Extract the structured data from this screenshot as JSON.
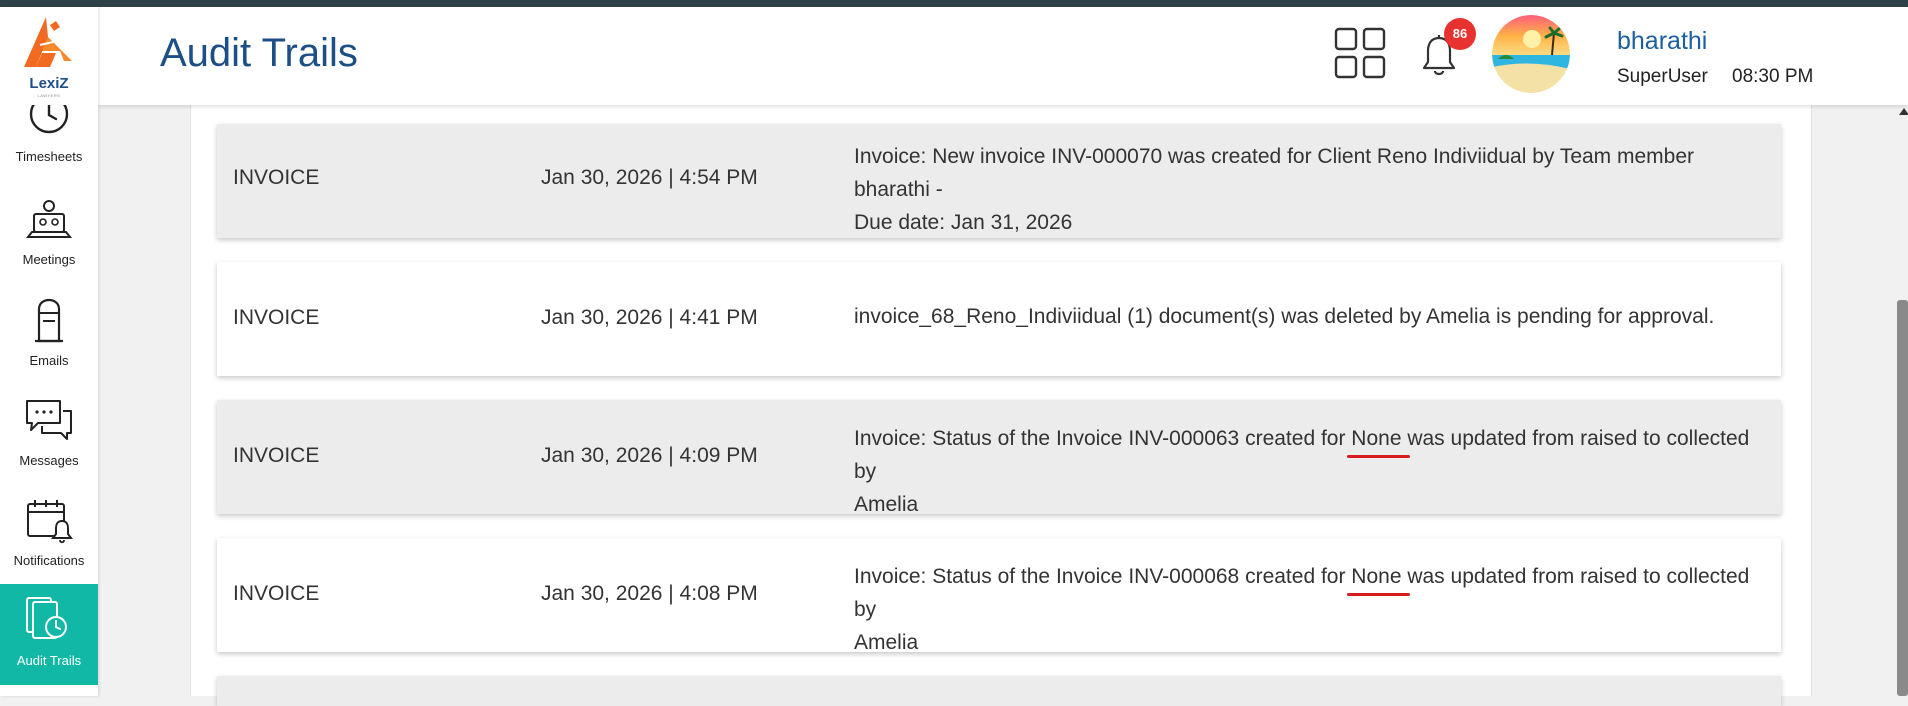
{
  "app": {
    "logo_text": "LexiZ",
    "logo_tagline": "LAWYERS"
  },
  "header": {
    "title": "Audit Trails",
    "notification_count": "86",
    "user_name": "bharathi",
    "user_role": "SuperUser",
    "time": "08:30 PM"
  },
  "sidebar": {
    "items": [
      {
        "label": "Timesheets",
        "icon": "clock-icon"
      },
      {
        "label": "Meetings",
        "icon": "meeting-icon"
      },
      {
        "label": "Emails",
        "icon": "mailbox-icon"
      },
      {
        "label": "Messages",
        "icon": "chat-icon"
      },
      {
        "label": "Notifications",
        "icon": "calendar-bell-icon"
      },
      {
        "label": "Audit Trails",
        "icon": "audit-icon",
        "active": true
      }
    ]
  },
  "audit_rows": [
    {
      "type": "INVOICE",
      "date": "Jan 30, 2026 | 4:54 PM",
      "desc_line1": "Invoice: New invoice INV-000070 was created for Client Reno Indiviidual by Team member bharathi -",
      "desc_line2": "Due date: Jan 31, 2026"
    },
    {
      "type": "INVOICE",
      "date": "Jan 30, 2026 | 4:41 PM",
      "desc_line1": "invoice_68_Reno_Indiviidual (1) document(s) was deleted by Amelia is pending for approval."
    },
    {
      "type": "INVOICE",
      "date": "Jan 30, 2026 | 4:09 PM",
      "desc_pre": "Invoice: Status of the Invoice INV-000063 created for ",
      "desc_mark": "None",
      "desc_post": " was updated from raised to collected by",
      "desc_line2": "Amelia"
    },
    {
      "type": "INVOICE",
      "date": "Jan 30, 2026 | 4:08 PM",
      "desc_pre": "Invoice: Status of the Invoice INV-000068 created for ",
      "desc_mark": "None",
      "desc_post": " was updated from raised to collected by",
      "desc_line2": "Amelia"
    }
  ],
  "colors": {
    "accent": "#12b8a6",
    "title": "#1b4f86",
    "badge": "#e8322f",
    "underline": "#d81c1c"
  }
}
